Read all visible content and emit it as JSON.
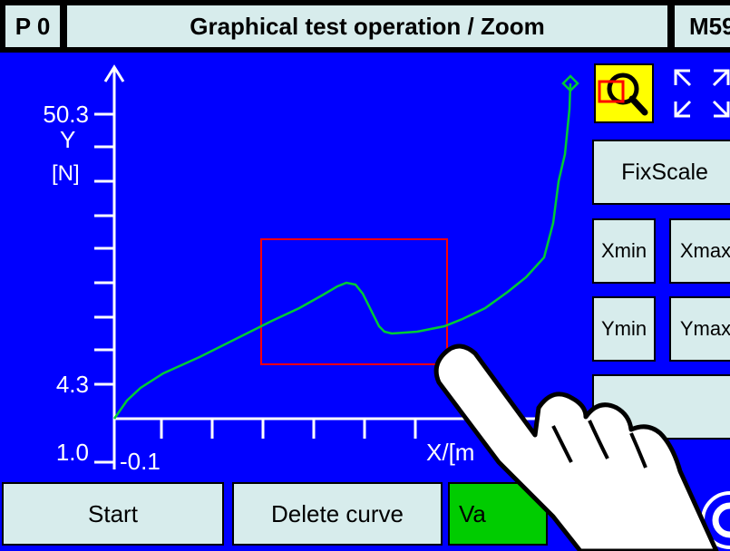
{
  "header": {
    "program": "P 0",
    "title": "Graphical test operation / Zoom",
    "mode": "M59"
  },
  "axis": {
    "y_top": "50.3",
    "y_name": "Y",
    "y_unit": "[N]",
    "y_mid": "4.3",
    "y_bottom": "1.0",
    "x_left": "-0.1",
    "x_label": "X/[m"
  },
  "buttons": {
    "fixscale": "FixScale",
    "xmin": "Xmin",
    "xmax": "Xmax",
    "ymin": "Ymin",
    "ymax": "Ymax",
    "start": "Start",
    "delete_curve": "Delete curve",
    "values": "Va"
  },
  "icons": {
    "zoom": "zoom-magnifier-icon",
    "full_view": "expand-corners-icon",
    "hand": "pointing-hand-icon",
    "round": "circular-arrow-icon"
  },
  "colors": {
    "background": "#0000ff",
    "curve": "#00cc33",
    "zoom_frame": "#ff0000",
    "zoom_button": "#ffff00",
    "values_button": "#00cc00"
  }
}
